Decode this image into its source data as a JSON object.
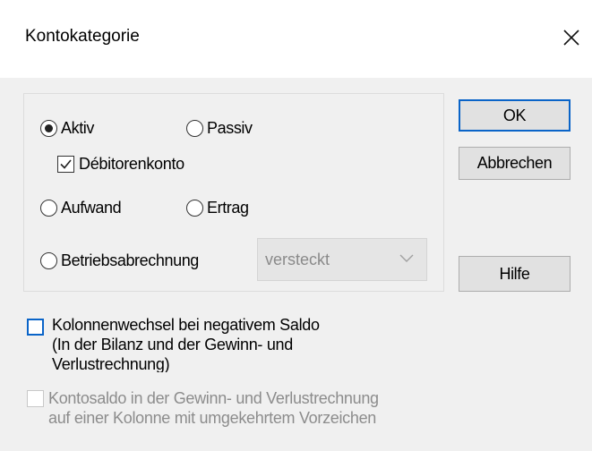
{
  "window": {
    "title": "Kontokategorie",
    "close_icon": "close-icon"
  },
  "group": {
    "radios": {
      "aktiv": {
        "label": "Aktiv",
        "selected": true
      },
      "passiv": {
        "label": "Passiv",
        "selected": false
      },
      "aufwand": {
        "label": "Aufwand",
        "selected": false
      },
      "ertrag": {
        "label": "Ertrag",
        "selected": false
      },
      "betriebsabrechnung": {
        "label": "Betriebsabrechnung",
        "selected": false
      }
    },
    "debitorenkonto": {
      "label": "Débitorenkonto",
      "checked": true
    },
    "betriebsabrechnung_select": {
      "value": "versteckt",
      "enabled": false
    }
  },
  "buttons": {
    "ok": "OK",
    "abbrechen": "Abbrechen",
    "hilfe": "Hilfe"
  },
  "options": {
    "kolonnenwechsel": {
      "line1": "Kolonnenwechsel bei negativem Saldo",
      "line2": "(In der Bilanz und der Gewinn- und",
      "line3": "Verlustrechnung)",
      "checked": false,
      "focused": true
    },
    "kontosaldo": {
      "line1": "Kontosaldo in der Gewinn- und Verlustrechnung",
      "line2": "auf einer Kolonne mit umgekehrtem Vorzeichen",
      "checked": false,
      "enabled": false
    }
  },
  "colors": {
    "accent": "#0a64c8",
    "dialog_bg": "#f0f0f0",
    "disabled_text": "#8c8c8c"
  }
}
